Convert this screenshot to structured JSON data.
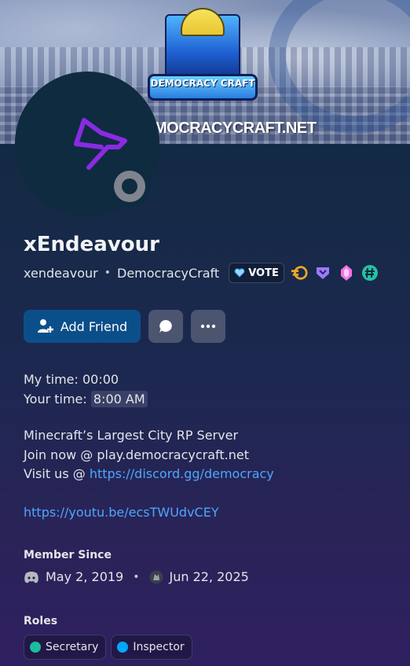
{
  "banner": {
    "logo_text": "DEMOCRACY CRAFT",
    "server_text": "MOCRACYCRAFT.NET"
  },
  "profile": {
    "display_name": "xEndeavour",
    "username": "xendeavour",
    "server_name": "DemocracyCraft",
    "guild_tag": "VOTE",
    "avatar_icon": "dog-head-icon",
    "status": "offline"
  },
  "badges": [
    "hypesquad-icon",
    "shield-badge-icon",
    "gem-icon",
    "hashtag-badge-icon"
  ],
  "actions": {
    "add_friend_label": "Add Friend"
  },
  "time": {
    "my_time_label": "My time:",
    "my_time_value": "00:00",
    "your_time_label": "Your time:",
    "your_time_value": "8:00 AM"
  },
  "bio": {
    "line1": "Minecraft’s Largest City RP Server",
    "line2": "Join now @ play.democracycraft.net",
    "line3_prefix": "Visit us @ ",
    "line3_link": "https://discord.gg/democracy",
    "line4_link": "https://youtu.be/ecsTWUdvCEY"
  },
  "member_since": {
    "title": "Member Since",
    "discord_date": "May 2, 2019",
    "server_date": "Jun 22, 2025"
  },
  "roles": {
    "title": "Roles",
    "items": [
      {
        "name": "Secretary",
        "color": "#1abc9c"
      },
      {
        "name": "Inspector",
        "color": "#00a8fc"
      }
    ]
  },
  "colors": {
    "accent": "#0b4f8a",
    "link": "#4ea6ff",
    "avatar_purple": "#8a2be2"
  }
}
